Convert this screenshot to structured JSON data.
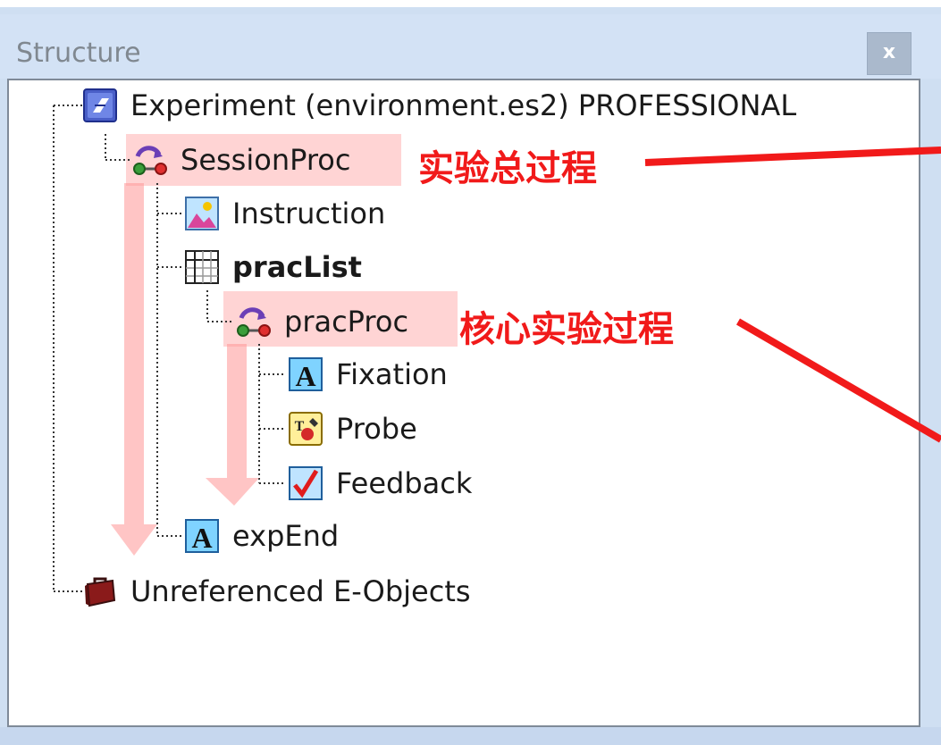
{
  "panel": {
    "title": "Structure",
    "close_label": "x"
  },
  "tree": {
    "root": "Experiment (environment.es2) PROFESSIONAL",
    "session_proc": "SessionProc",
    "instruction": "Instruction",
    "prac_list": "pracList",
    "prac_proc": "pracProc",
    "fixation": "Fixation",
    "probe": "Probe",
    "feedback": "Feedback",
    "exp_end": "expEnd",
    "unreferenced": "Unreferenced E-Objects"
  },
  "annotations": {
    "session_note": "实验总过程",
    "core_note": "核心实验过程"
  },
  "colors": {
    "annotation": "#f11a1a",
    "highlight": "#ffa0a0"
  }
}
